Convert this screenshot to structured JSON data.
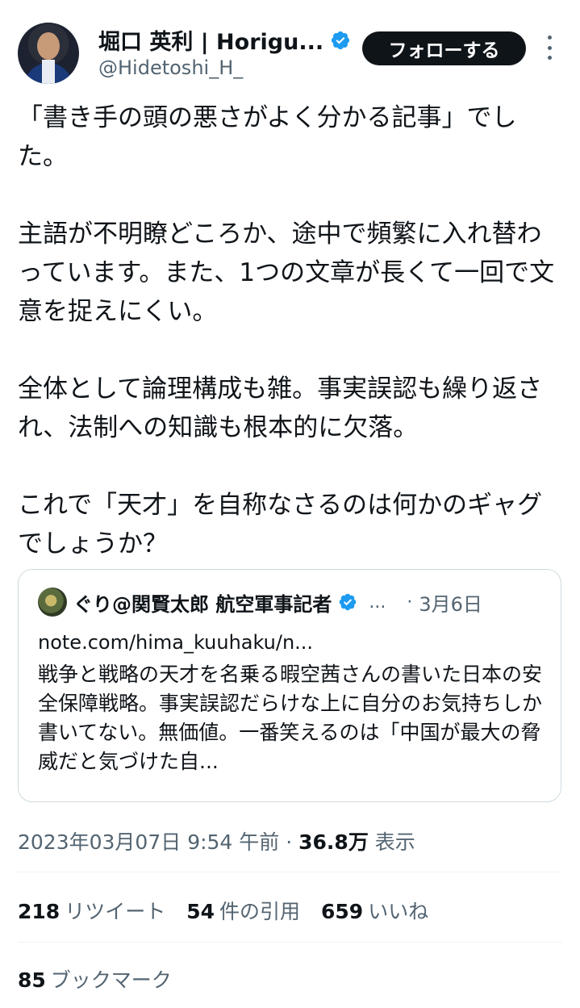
{
  "author": {
    "name": "堀口 英利 | Horigu...",
    "handle": "@Hidetoshi_H_",
    "follow_label": "フォローする"
  },
  "tweet": {
    "paragraphs": [
      "「書き手の頭の悪さがよく分かる記事」でした。",
      "主語が不明瞭どころか、途中で頻繁に入れ替わっています。また、1つの文章が長くて一回で文意を捉えにくい。",
      "全体として論理構成も雑。事実誤認も繰り返され、法制への知識も根本的に欠落。",
      "これで「天才」を自称なさるのは何かのギャグでしょうか？"
    ]
  },
  "quote": {
    "name": "ぐり@関賢太郎 航空軍事記者",
    "dots": "...",
    "separator": "·",
    "date": "3月6日",
    "url": "note.com/hima_kuuhaku/n...",
    "text": "戦争と戦略の天才を名乗る暇空茜さんの書いた日本の安全保障戦略。事実誤認だらけな上に自分のお気持ちしか書いてない。無価値。一番笑えるのは「中国が最大の脅威だと気づけた自..."
  },
  "meta": {
    "timestamp": "2023年03月07日 9:54 午前",
    "separator": "·",
    "views_count": "36.8万",
    "views_label": "表示"
  },
  "stats": {
    "retweets_count": "218",
    "retweets_label": "リツイート",
    "quotes_count": "54",
    "quotes_label": "件の引用",
    "likes_count": "659",
    "likes_label": "いいね",
    "bookmarks_count": "85",
    "bookmarks_label": "ブックマーク"
  },
  "colors": {
    "verified": "#1d9bf0",
    "secondary_text": "#536471",
    "primary_text": "#0f1419",
    "button_bg": "#0f1419"
  }
}
